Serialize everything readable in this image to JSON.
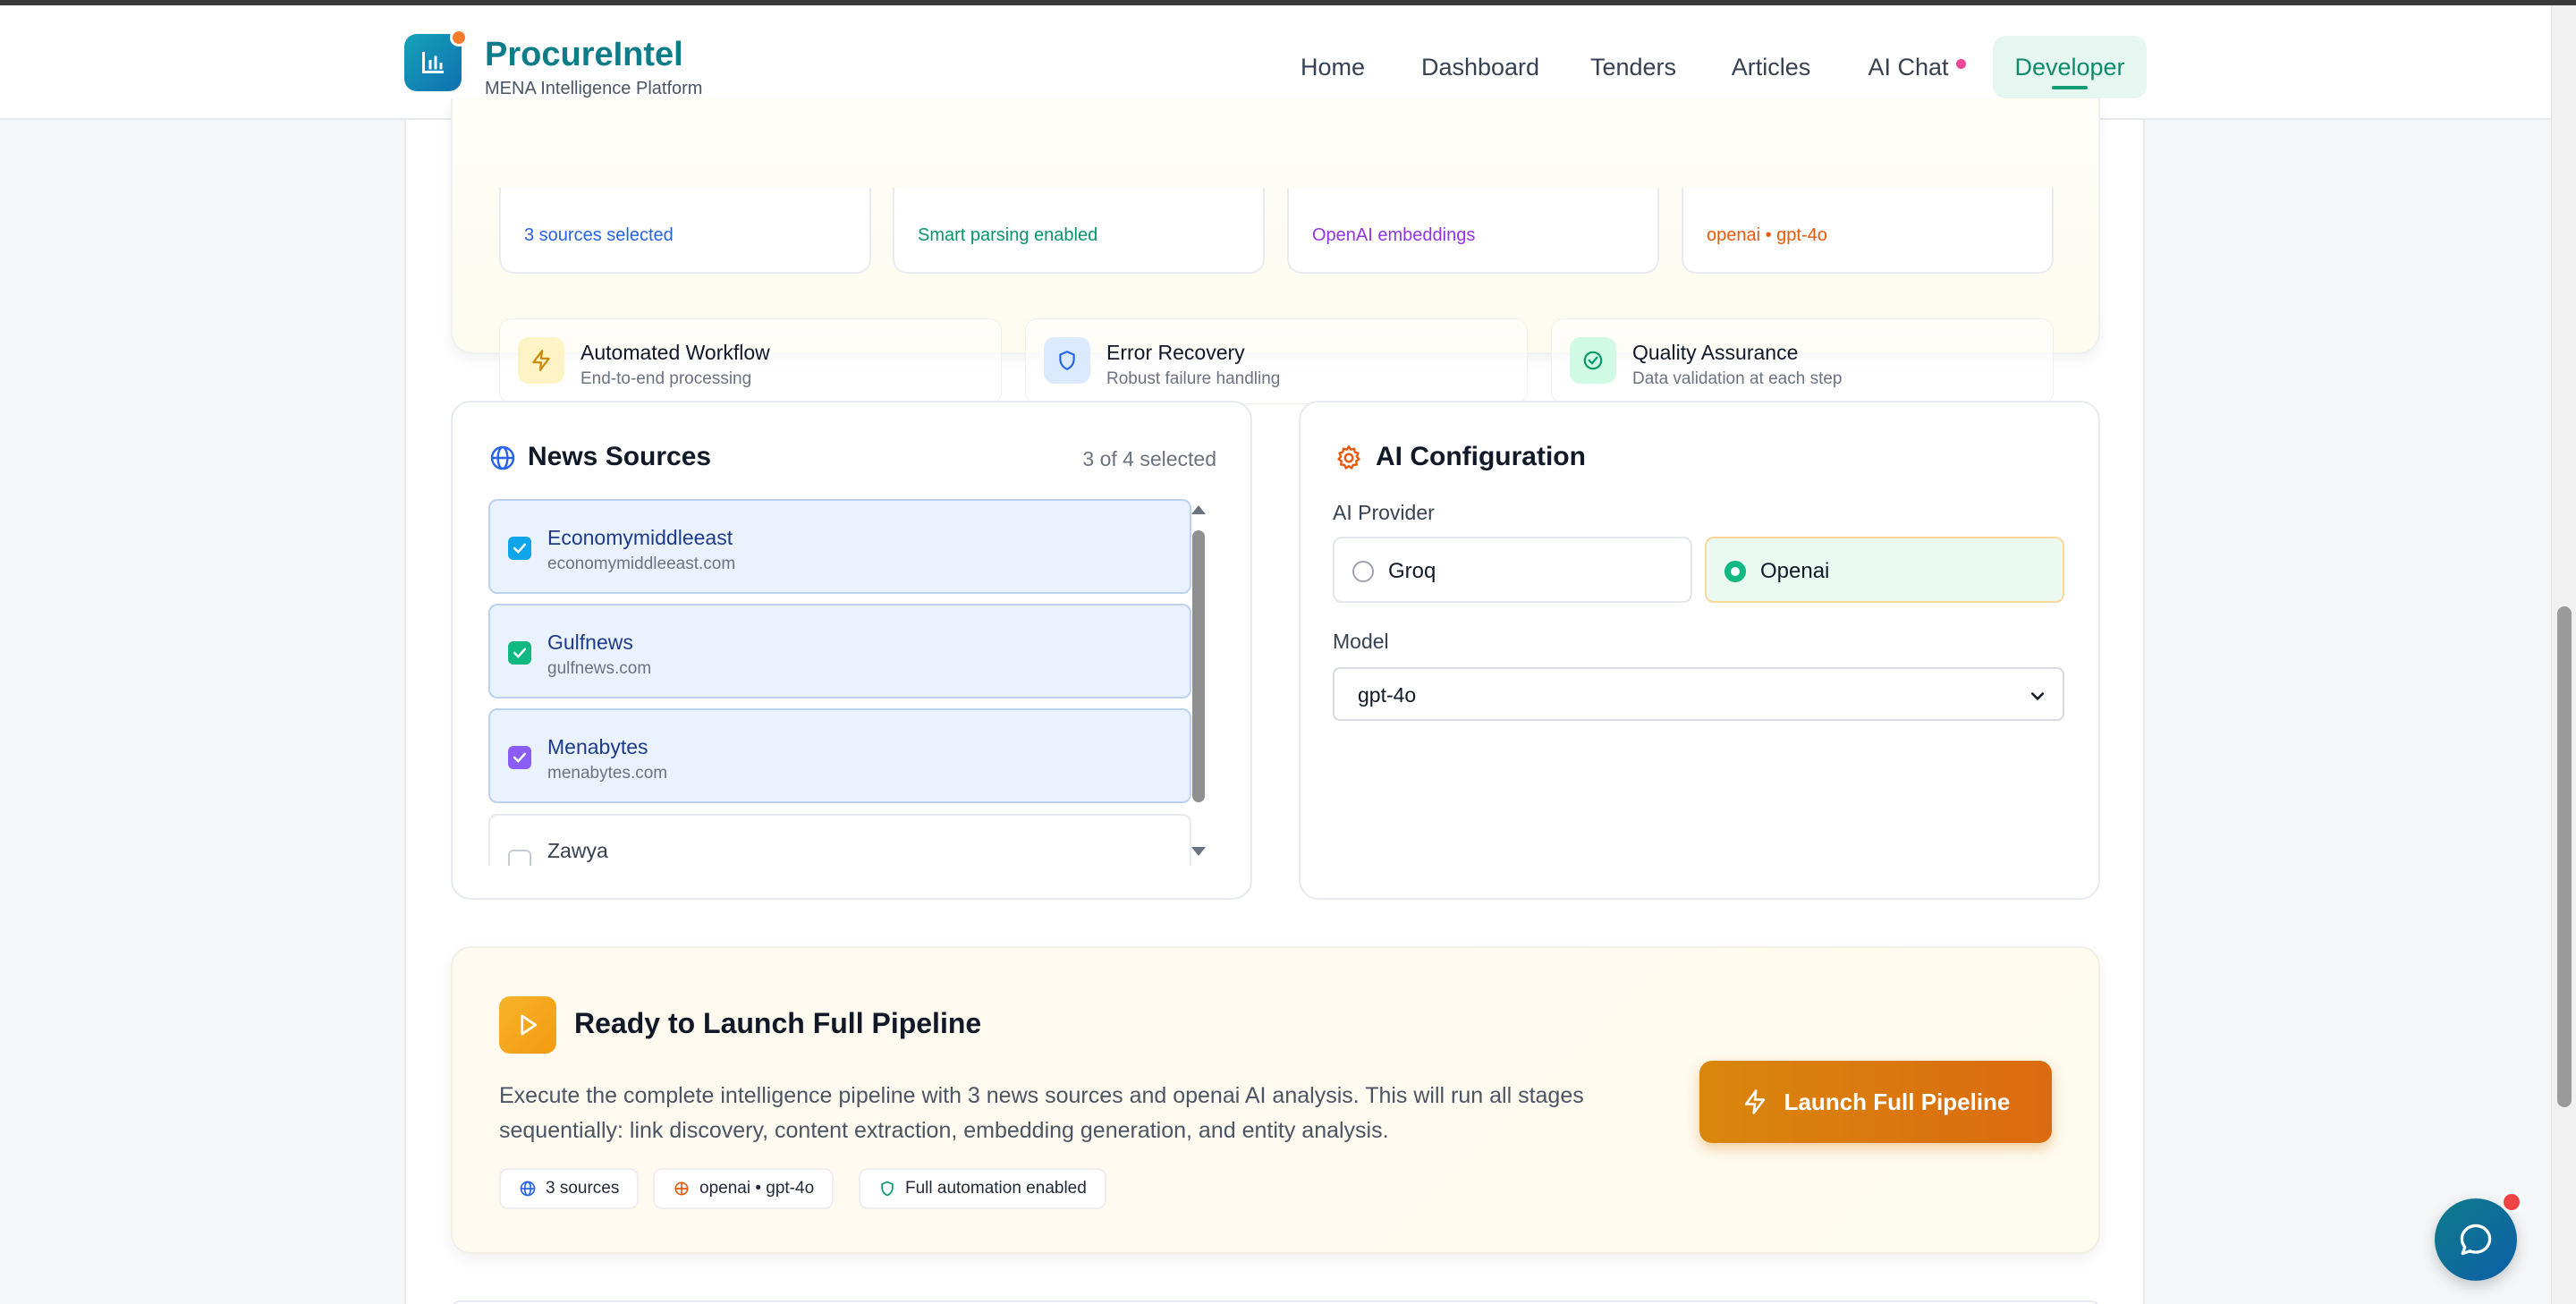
{
  "brand": {
    "name": "ProcureIntel",
    "subtitle": "MENA Intelligence Platform"
  },
  "nav": {
    "home": "Home",
    "dashboard": "Dashboard",
    "tenders": "Tenders",
    "articles": "Articles",
    "ai_chat": "AI Chat",
    "developer": "Developer"
  },
  "stats": [
    {
      "text": "3 sources selected",
      "color": "#2563eb"
    },
    {
      "text": "Smart parsing enabled",
      "color": "#059669"
    },
    {
      "text": "OpenAI embeddings",
      "color": "#9333ea"
    },
    {
      "text": "openai • gpt-4o",
      "color": "#ea580c"
    }
  ],
  "features": [
    {
      "title": "Automated Workflow",
      "sub": "End-to-end processing",
      "icon": "lightning-icon"
    },
    {
      "title": "Error Recovery",
      "sub": "Robust failure handling",
      "icon": "shield-icon"
    },
    {
      "title": "Quality Assurance",
      "sub": "Data validation at each step",
      "icon": "check-circle-icon"
    }
  ],
  "news_sources": {
    "title": "News Sources",
    "count": "3 of 4 selected",
    "items": [
      {
        "name": "Economymiddleeast",
        "domain": "economymiddleeast.com",
        "checked": true,
        "color": "#0ea5e9"
      },
      {
        "name": "Gulfnews",
        "domain": "gulfnews.com",
        "checked": true,
        "color": "#10b981"
      },
      {
        "name": "Menabytes",
        "domain": "menabytes.com",
        "checked": true,
        "color": "#8b5cf6"
      },
      {
        "name": "Zawya",
        "domain": "",
        "checked": false
      }
    ]
  },
  "ai_config": {
    "title": "AI Configuration",
    "provider_label": "AI Provider",
    "providers": [
      {
        "label": "Groq",
        "selected": false
      },
      {
        "label": "Openai",
        "selected": true
      }
    ],
    "model_label": "Model",
    "model_value": "gpt-4o"
  },
  "launch": {
    "title": "Ready to Launch Full Pipeline",
    "description": "Execute the complete intelligence pipeline with 3 news sources and openai AI analysis. This will run all stages sequentially: link discovery, content extraction, embedding generation, and entity analysis.",
    "button": "Launch Full Pipeline",
    "chips": [
      "3 sources",
      "openai • gpt-4o",
      "Full automation enabled"
    ]
  }
}
